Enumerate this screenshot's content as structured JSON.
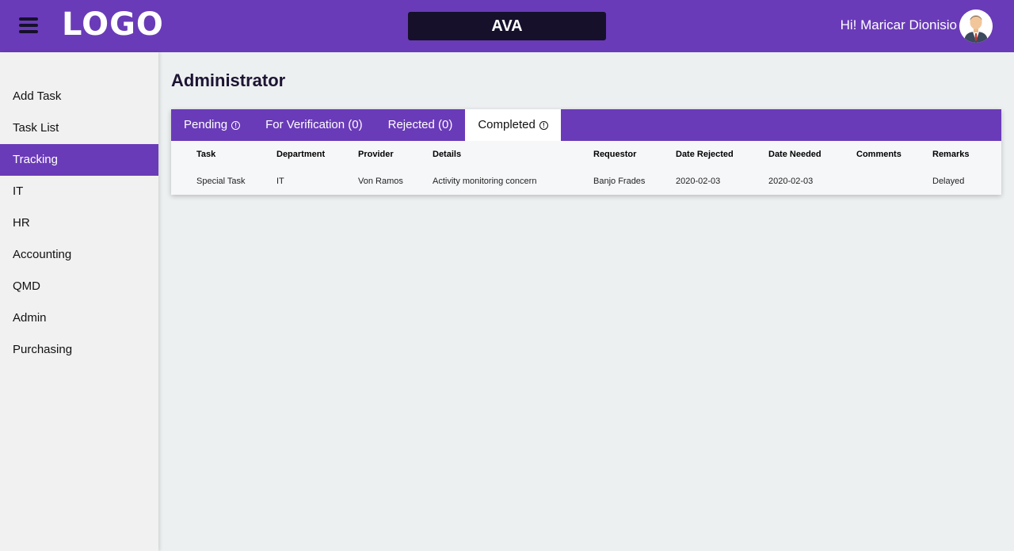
{
  "header": {
    "logo": "LOGO",
    "app_name": "AVA",
    "greeting": "Hi! Maricar Dionisio",
    "menu_icon": "hamburger-icon",
    "avatar_icon": "user-avatar-icon"
  },
  "sidebar": {
    "items": [
      {
        "label": "Add Task"
      },
      {
        "label": "Task List"
      },
      {
        "label": "Tracking",
        "active": true
      },
      {
        "label": "IT"
      },
      {
        "label": "HR"
      },
      {
        "label": "Accounting"
      },
      {
        "label": "QMD"
      },
      {
        "label": "Admin"
      },
      {
        "label": "Purchasing"
      }
    ]
  },
  "main": {
    "title": "Administrator",
    "tabs": [
      {
        "label": "Pending",
        "icon": "info-icon"
      },
      {
        "label": "For Verification (0)"
      },
      {
        "label": "Rejected (0)"
      },
      {
        "label": "Completed",
        "icon": "info-icon",
        "active": true
      }
    ],
    "table": {
      "headers": [
        "Task",
        "Department",
        "Provider",
        "Details",
        "Requestor",
        "Date Rejected",
        "Date Needed",
        "Comments",
        "Remarks"
      ],
      "rows": [
        [
          "Special Task",
          "IT",
          "Von Ramos",
          "Activity monitoring concern",
          "Banjo Frades",
          "2020-02-03",
          "2020-02-03",
          "",
          "Delayed"
        ]
      ]
    }
  },
  "colors": {
    "primary": "#6a3bb8",
    "dark": "#16102b",
    "background": "#edf0f1"
  }
}
